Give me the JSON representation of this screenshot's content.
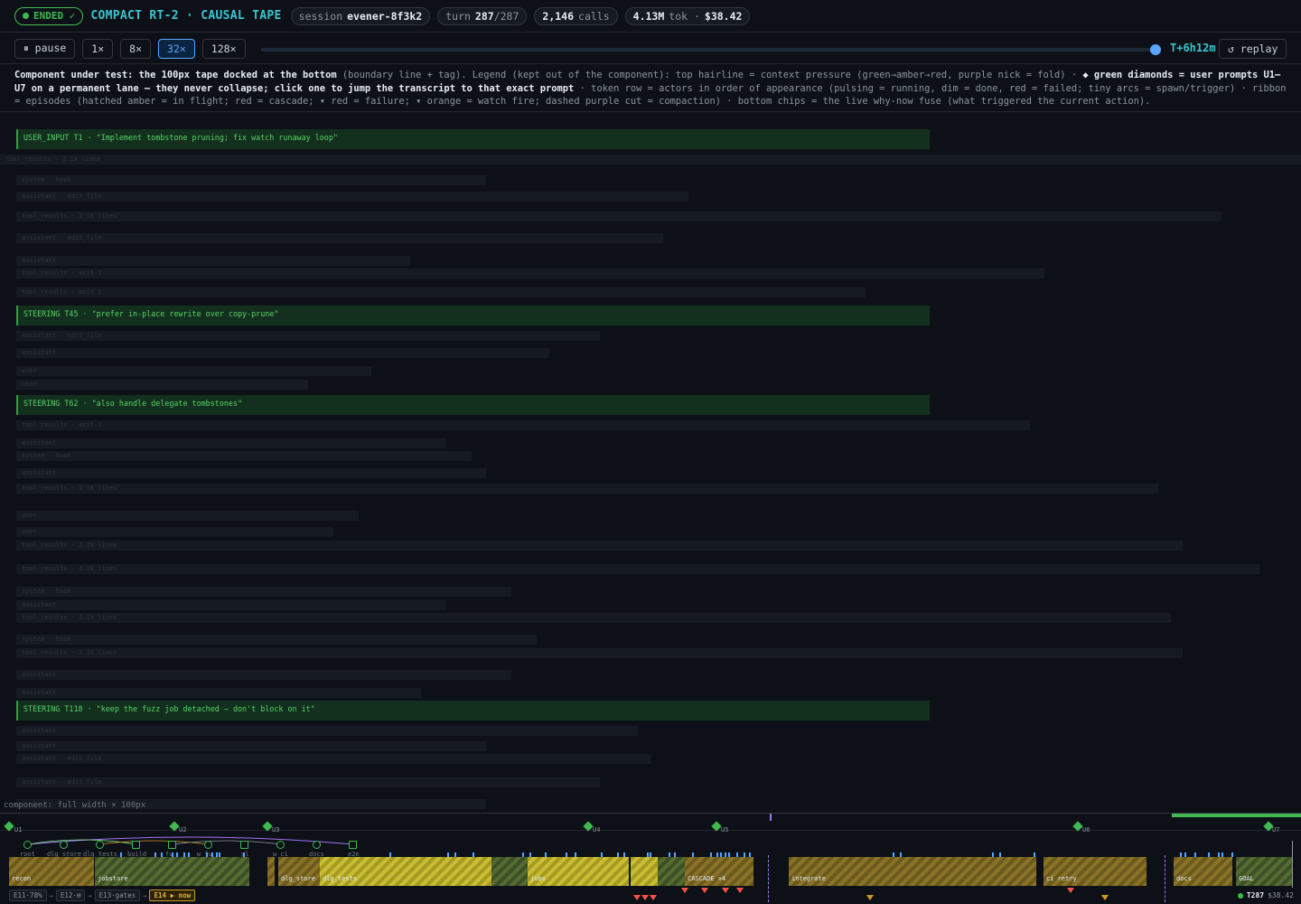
{
  "header": {
    "status": "ENDED ✓",
    "title": "COMPACT RT-2 · CAUSAL TAPE",
    "session_label": "session",
    "session_id": "evener-8f3k2",
    "turn_label": "turn",
    "turn_current": "287",
    "turn_total": "/287",
    "calls_value": "2,146",
    "calls_label": "calls",
    "tokens": "4.13M",
    "tokens_suffix": "tok ·",
    "cost": "$38.42"
  },
  "controls": {
    "pause": "⏸ pause",
    "speeds": [
      "1×",
      "8×",
      "32×",
      "128×"
    ],
    "active_speed": "32×",
    "progress": 1.0,
    "time": "T+6h12m",
    "replay": "↺ replay"
  },
  "legend": {
    "part1": "Component under test: the 100px tape docked at the bottom",
    "part2": " (boundary line + tag). Legend (kept out of the component): top hairline = context pressure (green→amber→red, purple nick = fold) · ",
    "part3": "◆ green diamonds = user prompts U1–U7 on a permanent lane — they never collapse; click one to jump the transcript to that exact prompt",
    "part4": " · token row = actors in order of appearance (pulsing = running, dim = done, red = failed; tiny arcs = spawn/trigger) · ribbon = episodes (hatched amber = in flight; red = cascade; ▾ red = failure; ▾ orange = watch fire; dashed purple cut = compaction) · bottom chips = the live why-now fuse (what triggered the current action)."
  },
  "transcript": {
    "steering": [
      "USER_INPUT T1 · \"Implement tombstone pruning; fix watch runaway loop\"",
      "STEERING T45 · \"prefer in-place rewrite over copy-prune\"",
      "STEERING T62 · \"also handle delegate tombstones\"",
      "STEERING T118 · \"keep the fuzz job detached — don't block on it\""
    ],
    "rows": [
      "tool_results · 2.1k lines",
      "system · hook",
      "assistant · edit_file",
      "tool_results · 2.1k lines",
      "assistant · edit_file",
      "assistant",
      "tool_results · exit 1",
      "tool_results · exit 1",
      "assistant · edit_file",
      "assistant",
      "user",
      "user",
      "tool_results · exit 1",
      "assistant",
      "system · hook",
      "assistant",
      "tool_results · 2.1k lines",
      "user",
      "user",
      "tool_results · 2.1k lines",
      "tool_results · 2.1k lines",
      "system · hook",
      "assistant",
      "tool_results · 2.1k lines",
      "system · hook",
      "tool_results · 2.1k lines",
      "assistant",
      "assistant",
      "assistant",
      "assistant",
      "assistant · edit_file",
      "assistant · edit_file",
      ""
    ],
    "component_label": "component: full width × 100px"
  },
  "tape": {
    "prompts": [
      "U1",
      "U2",
      "U3",
      "U4",
      "U5",
      "U6",
      "U7"
    ],
    "actors": [
      "root",
      "dlg_store",
      "dlg_tests",
      "build",
      "fu",
      "w_fu",
      "gl",
      "w_ci",
      "docs",
      "e2e"
    ],
    "episodes": [
      "recon",
      "jobstore",
      "dlg_store",
      "dlg_tests",
      "jobs",
      "CASCADE ×4",
      "integrate",
      "ci retry",
      "docs",
      "GOAL"
    ],
    "chips": [
      "E11·78%",
      "E12·⊞",
      "E13·gates",
      "E14 ▶ now"
    ],
    "live_turn": "T287",
    "live_cost": "$38.42",
    "colors": {
      "accent": "#39c5cf",
      "ok": "#3fb950",
      "fold": "#a371f7",
      "fail": "#f85149",
      "watch": "#d29922",
      "speed": "#58a6ff"
    }
  }
}
